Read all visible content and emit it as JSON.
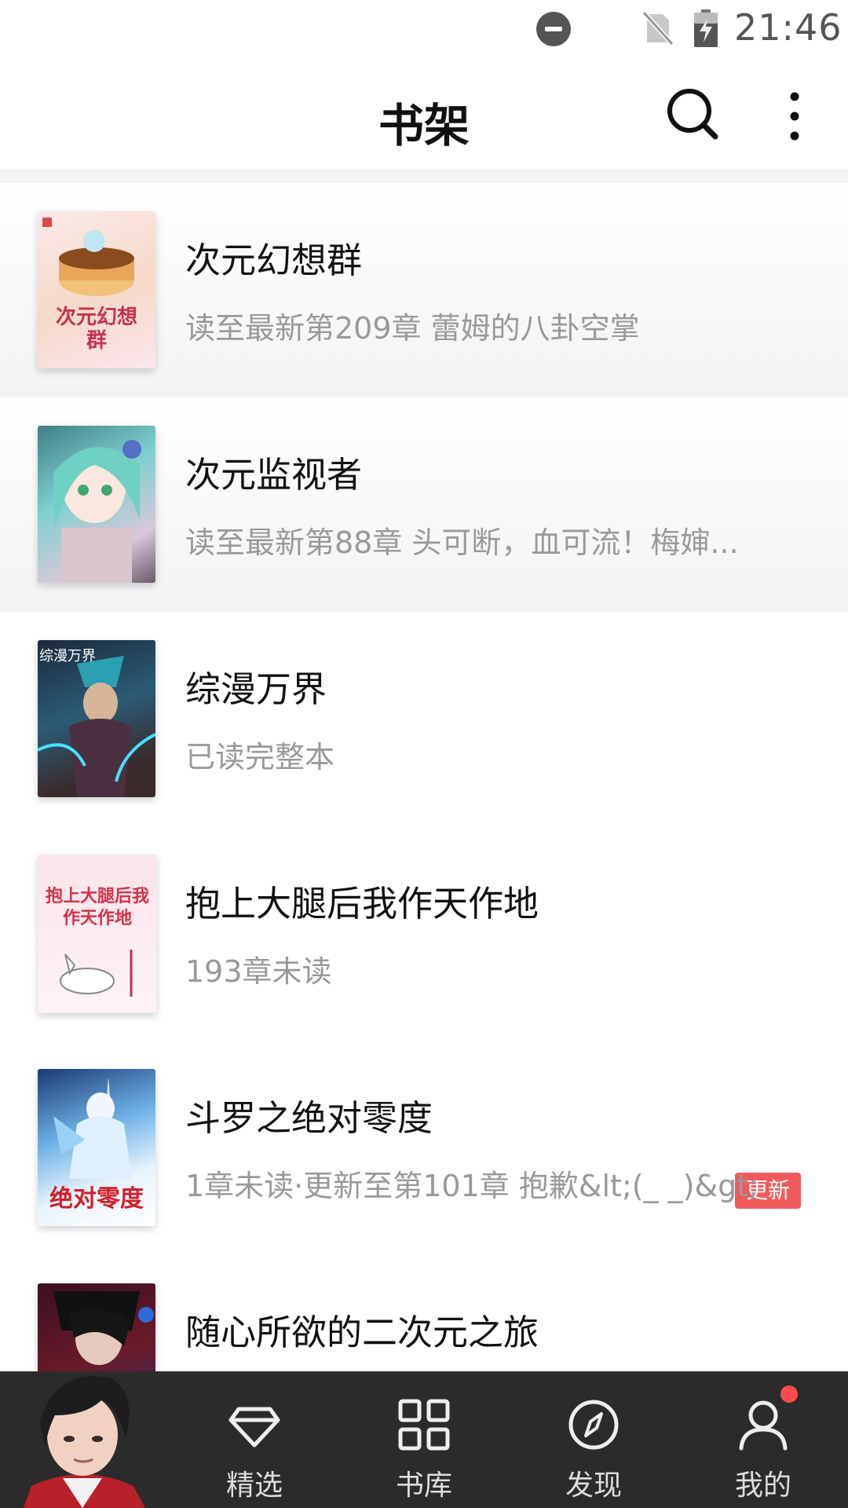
{
  "status_bar": {
    "time": "21:46",
    "icons": [
      "do-not-disturb-icon",
      "no-sim-icon",
      "battery-charging-icon"
    ]
  },
  "header": {
    "title": "书架",
    "actions": [
      "search-icon",
      "more-vertical-icon"
    ]
  },
  "books": [
    {
      "title": "次元幻想群",
      "status": "读至最新第209章 蕾姆的八卦空掌",
      "cover_text": "次元幻想群",
      "badge": ""
    },
    {
      "title": "次元监视者",
      "status": "读至最新第88章 头可断，血可流！梅婶...",
      "cover_text": "",
      "badge": ""
    },
    {
      "title": "综漫万界",
      "status": "已读完整本",
      "cover_text": "综漫万界",
      "badge": ""
    },
    {
      "title": "抱上大腿后我作天作地",
      "status": "193章未读",
      "cover_text": "抱上大腿后我作天作地",
      "badge": ""
    },
    {
      "title": "斗罗之绝对零度",
      "status": "1章未读·更新至第101章 抱歉&lt;(_ _)&gt;",
      "cover_text": "绝对零度",
      "badge": "更新"
    },
    {
      "title": "随心所欲的二次元之旅",
      "status": "",
      "cover_text": "",
      "badge": ""
    }
  ],
  "bottom_nav": {
    "items": [
      {
        "label": "精选",
        "icon": "diamond-icon"
      },
      {
        "label": "书库",
        "icon": "grid-icon"
      },
      {
        "label": "发现",
        "icon": "compass-icon"
      },
      {
        "label": "我的",
        "icon": "user-icon"
      }
    ],
    "notification_dot_color": "#ff4b4b"
  },
  "colors": {
    "badge": "#f05a5a",
    "nav_background": "#2b2b2b",
    "secondary_text": "#999999"
  }
}
